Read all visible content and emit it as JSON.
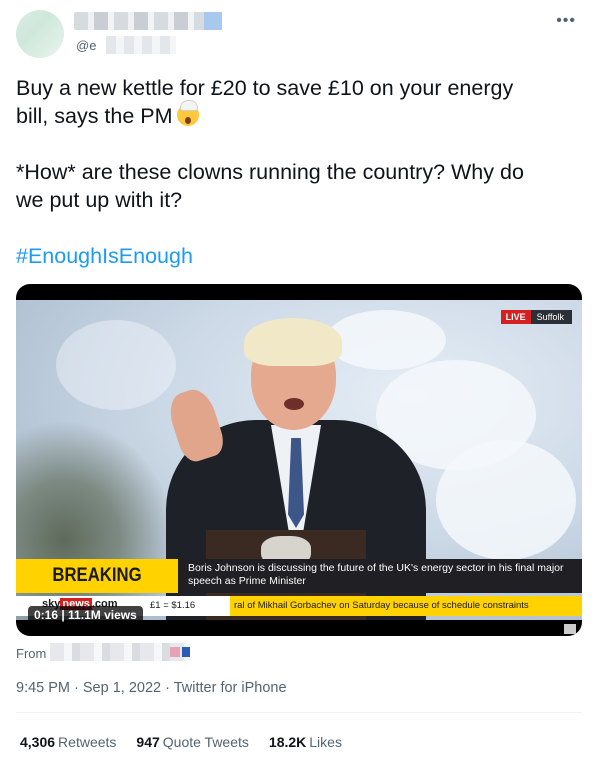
{
  "author": {
    "handle_prefix": "@e"
  },
  "tweet": {
    "line1": "Buy a new kettle for £20 to save £10 on your energy",
    "line2": "bill, says the PM",
    "line3": "*How* are these clowns running the country? Why do",
    "line4": "we put up with it?",
    "hashtag": "#EnoughIsEnough",
    "emoji": "exploding-head-emoji"
  },
  "video": {
    "live_label": "LIVE",
    "location": "Suffolk",
    "breaking_label": "BREAKING NEWS",
    "headline": "Boris Johnson is discussing the future of the UK's energy sector in his final major speech as Prime Minister",
    "channel_sky": "sky",
    "channel_news": "news",
    "channel_com": ".com",
    "fx_rate": "£1 = $1.16",
    "ticker": "ral of Mikhail Gorbachev on Saturday because of schedule constraints",
    "views": "0:16 | 11.1M views"
  },
  "footer": {
    "from_label": "From",
    "meta": "9:45 PM · Sep 1, 2022 · Twitter for iPhone",
    "retweets_count": "4,306",
    "retweets_label": "Retweets",
    "quotes_count": "947",
    "quotes_label": "Quote Tweets",
    "likes_count": "18.2K",
    "likes_label": "Likes"
  },
  "colors": {
    "link": "#1d9bf0",
    "breaking_yellow": "#ffd200",
    "live_red": "#d42020"
  }
}
